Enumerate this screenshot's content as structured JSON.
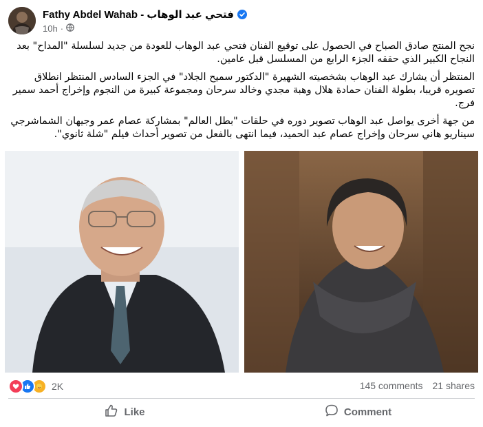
{
  "post": {
    "author": "Fathy Abdel Wahab - فتحي عبد الوهاب",
    "time": "10h",
    "separator": "·",
    "paragraphs": [
      "نجح المنتج صادق الصباح في الحصول على توقيع الفنان فتحي عبد الوهاب للعودة من جديد لسلسلة \"المداح\" بعد النجاح الكبير الذي حققه الجزء الرابع من المسلسل قبل عامين.",
      "المنتظر أن يشارك عبد الوهاب بشخصيته الشهيرة \"الدكتور سميح الجلاد\" في الجزء السادس المنتظر انطلاق تصويره قريبا، بطولة الفنان حمادة هلال وهبة مجدي وخالد سرحان ومجموعة كبيرة من النجوم وإخراج أحمد سمير فرج.",
      "من جهة أخرى يواصل عبد الوهاب تصوير دوره في حلقات \"بطل العالم\" بمشاركة عصام عمر وجيهان الشماشرجي سيناريو هاني سرحان وإخراج عصام عبد الحميد، فيما انتهى بالفعل من تصوير أحداث فيلم \"شلة ثانوي\"."
    ]
  },
  "stats": {
    "reactions_count": "2K",
    "comments": "145 comments",
    "shares": "21 shares",
    "reaction_types": [
      "love-icon",
      "like-icon",
      "care-icon"
    ]
  },
  "actions": {
    "like_label": "Like",
    "comment_label": "Comment"
  },
  "colors": {
    "text": "#050505",
    "secondary": "#65676b",
    "verified": "#1877f2",
    "love": "#f33e58",
    "like": "#1877f2",
    "care": "#f7b125"
  }
}
